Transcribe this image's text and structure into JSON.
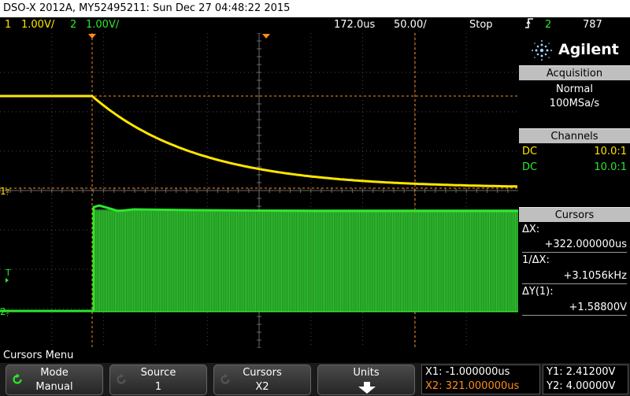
{
  "title": "DSO-X 2012A, MY52495211: Sun Dec 27 04:48:22 2015",
  "status": {
    "ch1_num": "1",
    "ch1_scale": "1.00V/",
    "ch2_num": "2",
    "ch2_scale": "1.00V/",
    "time_delay": "172.0",
    "time_delay_unit": "us",
    "time_scale": "50.00",
    "time_scale_unit": "/",
    "run_state": "Stop",
    "trigger_channel": "2",
    "trigger_level": "787"
  },
  "brand": "Agilent",
  "acquisition": {
    "header": "Acquisition",
    "mode": "Normal",
    "rate": "100MSa/s"
  },
  "channels": {
    "header": "Channels",
    "ch1_coupling": "DC",
    "ch1_probe": "10.0:1",
    "ch2_coupling": "DC",
    "ch2_probe": "10.0:1"
  },
  "cursors_panel": {
    "header": "Cursors",
    "dx_label": "ΔX:",
    "dx_value": "+322.000000us",
    "inv_dx_label": "1/ΔX:",
    "inv_dx_value": "+3.1056kHz",
    "dy_label": "ΔY(1):",
    "dy_value": "+1.58800V"
  },
  "marker_labels": {
    "ch1": "1",
    "ch2": "2",
    "trigger": "T"
  },
  "menu_title": "Cursors Menu",
  "softkeys": [
    {
      "label": "Mode",
      "value": "Manual"
    },
    {
      "label": "Source",
      "value": "1"
    },
    {
      "label": "Cursors",
      "value": "X2"
    },
    {
      "label": "Units",
      "value": ""
    }
  ],
  "readouts": {
    "x1": "X1: -1.000000us",
    "x2": "X2: 321.000000us",
    "y1": "Y1: 2.41200V",
    "y2": "Y2: 4.00000V"
  },
  "colors": {
    "ch1": "#ffe600",
    "ch2": "#2ee62e",
    "cursor": "#ff8c1a"
  },
  "icons": {
    "trigger": "rising-edge-icon",
    "mode_key": "cycle-arrow-icon",
    "units_key": "down-arrow-icon"
  }
}
